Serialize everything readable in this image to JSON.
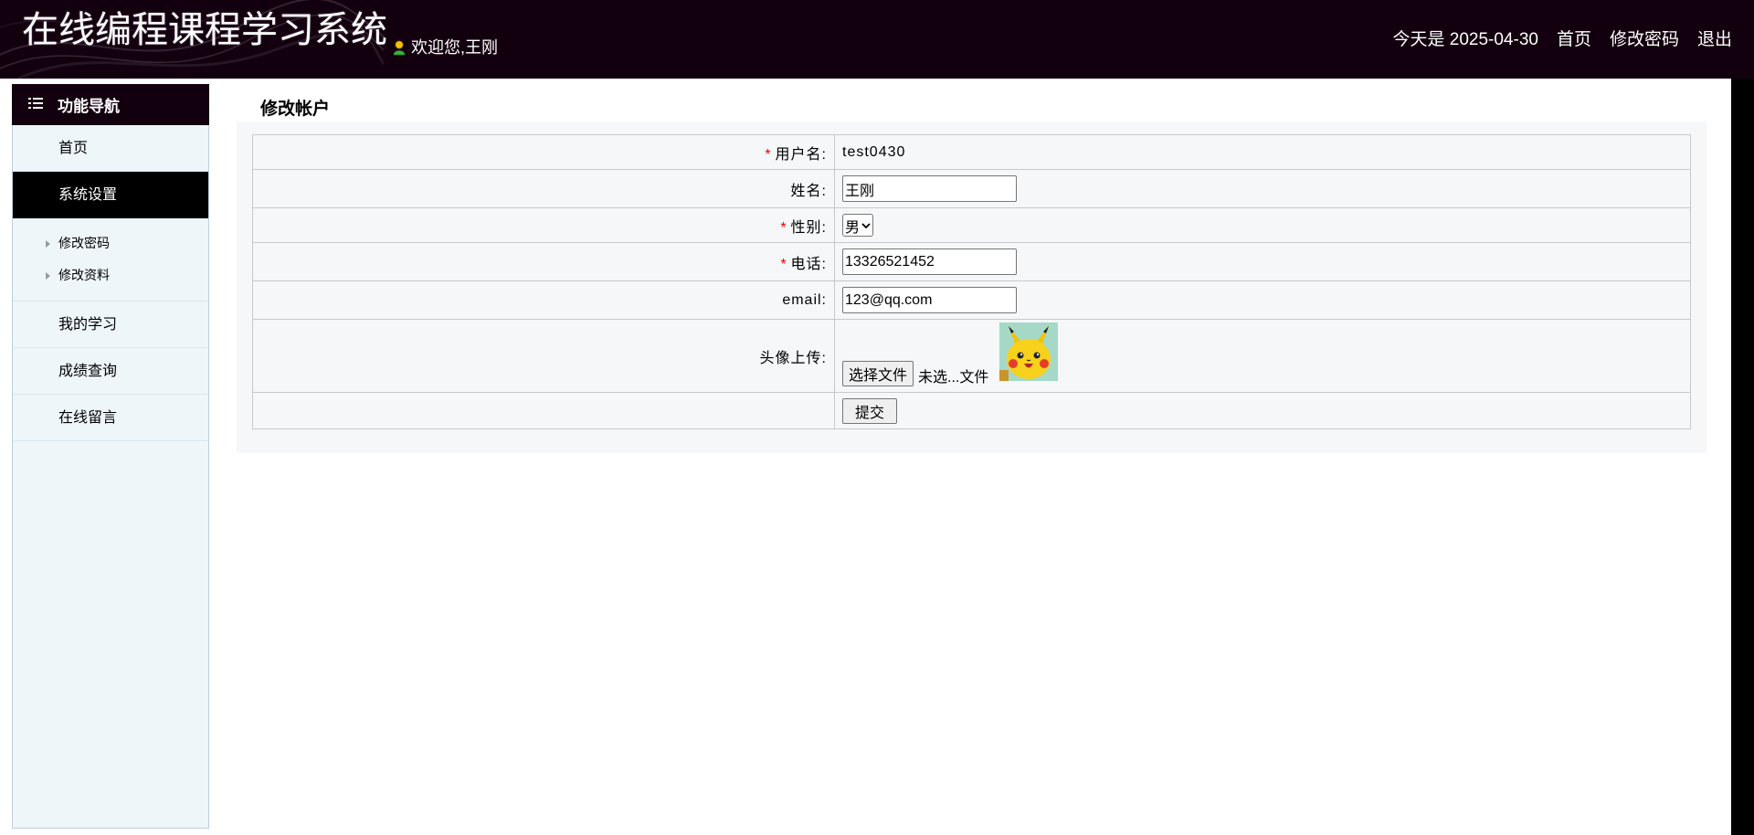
{
  "header": {
    "app_title": "在线编程课程学习系统",
    "welcome_text": "欢迎您,王刚",
    "date_text": "今天是 2025-04-30",
    "nav": [
      "首页",
      "修改密码",
      "退出"
    ]
  },
  "sidebar": {
    "title": "功能导航",
    "items": [
      {
        "label": "首页"
      },
      {
        "label": "系统设置",
        "active": true
      },
      {
        "label": "我的学习"
      },
      {
        "label": "成绩查询"
      },
      {
        "label": "在线留言"
      }
    ],
    "sub_items": [
      "修改密码",
      "修改资料"
    ]
  },
  "main": {
    "title": "修改帐户",
    "form": {
      "username_label": "用户名:",
      "username_value": "test0430",
      "name_label": "姓名:",
      "name_value": "王刚",
      "gender_label": "性别:",
      "gender_value": "男",
      "phone_label": "电话:",
      "phone_value": "13326521452",
      "email_label": "email:",
      "email_value": "123@qq.com",
      "avatar_label": "头像上传:",
      "file_button": "选择文件",
      "file_status": "未选...文件",
      "submit_label": "提交"
    }
  },
  "colors": {
    "header_bg": "#13000f",
    "sidebar_bg": "#eef6fa",
    "active_bg": "#000000",
    "required": "#ee0000"
  }
}
